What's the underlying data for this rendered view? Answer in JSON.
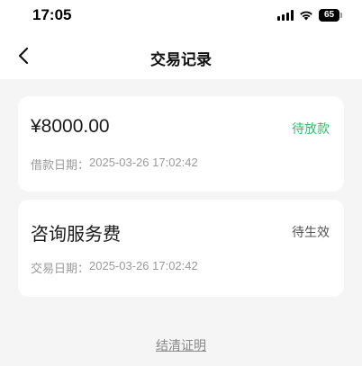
{
  "status_bar": {
    "time": "17:05",
    "battery": "65"
  },
  "header": {
    "title": "交易记录",
    "back_icon": "chevron-left-icon"
  },
  "records": [
    {
      "amount": "¥8000.00",
      "status": "待放款",
      "status_color": "#2bbf6a",
      "date_label": "借款日期：",
      "date_value": "2025-03-26 17:02:42"
    },
    {
      "name": "咨询服务费",
      "status": "待生效",
      "status_color": "#555555",
      "date_label": "交易日期：",
      "date_value": "2025-03-26 17:02:42"
    }
  ],
  "footer": {
    "link_label": "结清证明"
  },
  "colors": {
    "background": "#f5f5f5",
    "card": "#ffffff",
    "accent_green": "#2bbf6a"
  }
}
